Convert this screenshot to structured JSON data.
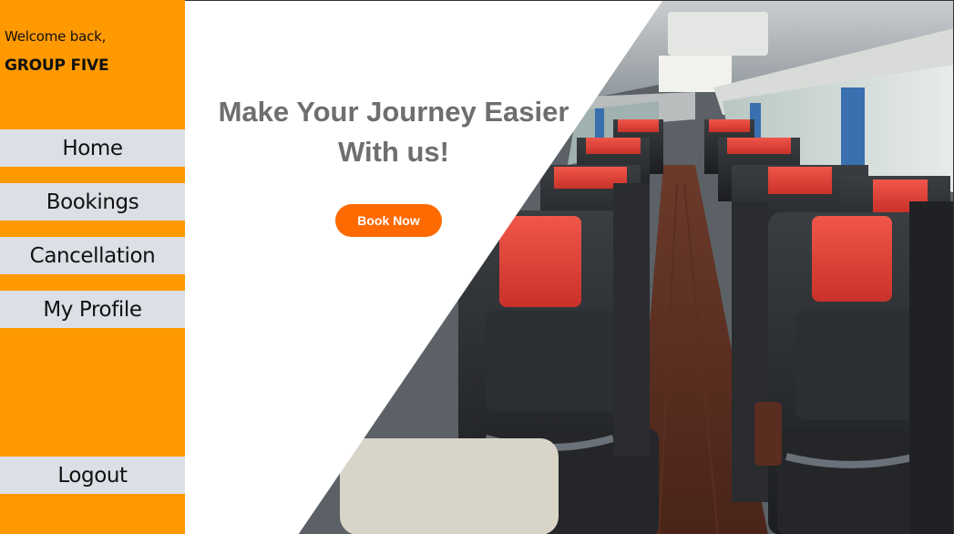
{
  "sidebar": {
    "welcome_text": "Welcome back,",
    "user_name": "GROUP FIVE",
    "nav": {
      "home": "Home",
      "bookings": "Bookings",
      "cancellation": "Cancellation",
      "profile": "My Profile",
      "logout": "Logout"
    }
  },
  "hero": {
    "headline_line1": "Make Your Journey Easier",
    "headline_line2": "With us!",
    "cta_label": "Book Now",
    "image_subject": "bus-interior-seats"
  },
  "colors": {
    "sidebar_bg": "#ff9900",
    "nav_item_bg": "#dcdfe6",
    "cta_bg": "#ff6a00",
    "headline_text": "#6e6e6e",
    "seat_headrest": "#e8453c"
  }
}
